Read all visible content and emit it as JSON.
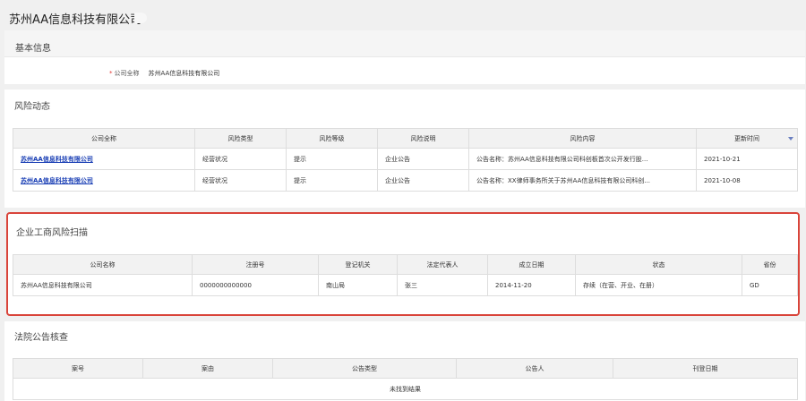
{
  "page": {
    "title": "苏州AA信息科技有限公司"
  },
  "basic_info": {
    "title": "基本信息",
    "required_mark": "*",
    "field_label": "公司全称",
    "field_value": "苏州AA信息科技有限公司"
  },
  "risk": {
    "title": "风险动态",
    "headers": [
      "公司全称",
      "风险类型",
      "风险等级",
      "风险说明",
      "风险内容",
      "更新时间"
    ],
    "rows": [
      [
        "苏州AA信息科技有限公司",
        "经营状况",
        "提示",
        "企业公告",
        "公告名称：苏州AA信息科技有限公司科创板首次公开发行股...",
        "2021-10-21"
      ],
      [
        "苏州AA信息科技有限公司",
        "经营状况",
        "提示",
        "企业公告",
        "公告名称：XX律师事务所关于苏州AA信息科技有限公司科创...",
        "2021-10-08"
      ]
    ]
  },
  "business": {
    "title": "企业工商风险扫描",
    "headers": [
      "公司名称",
      "注册号",
      "登记机关",
      "法定代表人",
      "成立日期",
      "状态",
      "省份"
    ],
    "rows": [
      [
        "苏州AA信息科技有限公司",
        "0000000000000",
        "南山局",
        "张三",
        "2014-11-20",
        "存续（在营、开业、在册）",
        "GD"
      ]
    ]
  },
  "court": {
    "title": "法院公告核查",
    "headers": [
      "案号",
      "案由",
      "公告类型",
      "公告人",
      "刊登日期"
    ],
    "empty_text": "未找到结果"
  }
}
